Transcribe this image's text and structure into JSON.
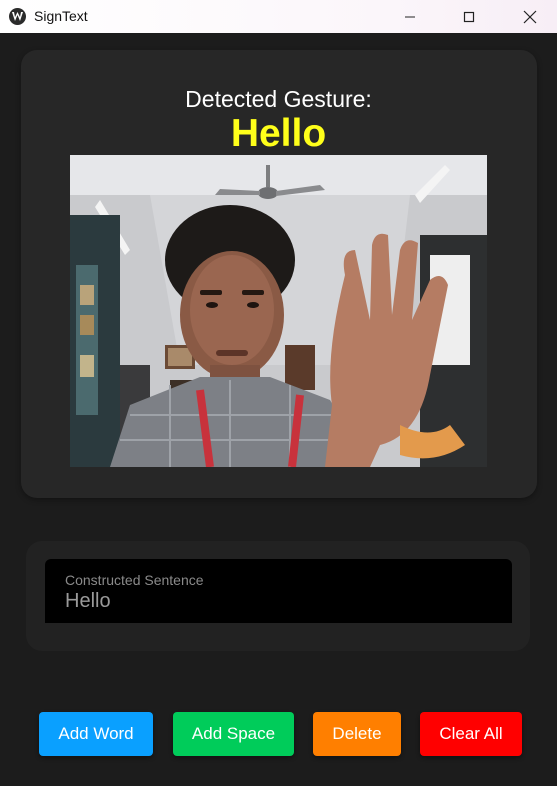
{
  "window": {
    "title": "SignText"
  },
  "gesture": {
    "label": "Detected Gesture:",
    "value": "Hello"
  },
  "camera": {
    "feed_icon": "camera-feed"
  },
  "sentence": {
    "label": "Constructed Sentence",
    "value": "Hello"
  },
  "buttons": {
    "add_word": "Add Word",
    "add_space": "Add Space",
    "delete": "Delete",
    "clear_all": "Clear All"
  },
  "colors": {
    "gesture_value": "#ffff1a",
    "add_word": "#0aa0ff",
    "add_space": "#00cc5a",
    "delete": "#ff7f00",
    "clear_all": "#ff0000"
  }
}
